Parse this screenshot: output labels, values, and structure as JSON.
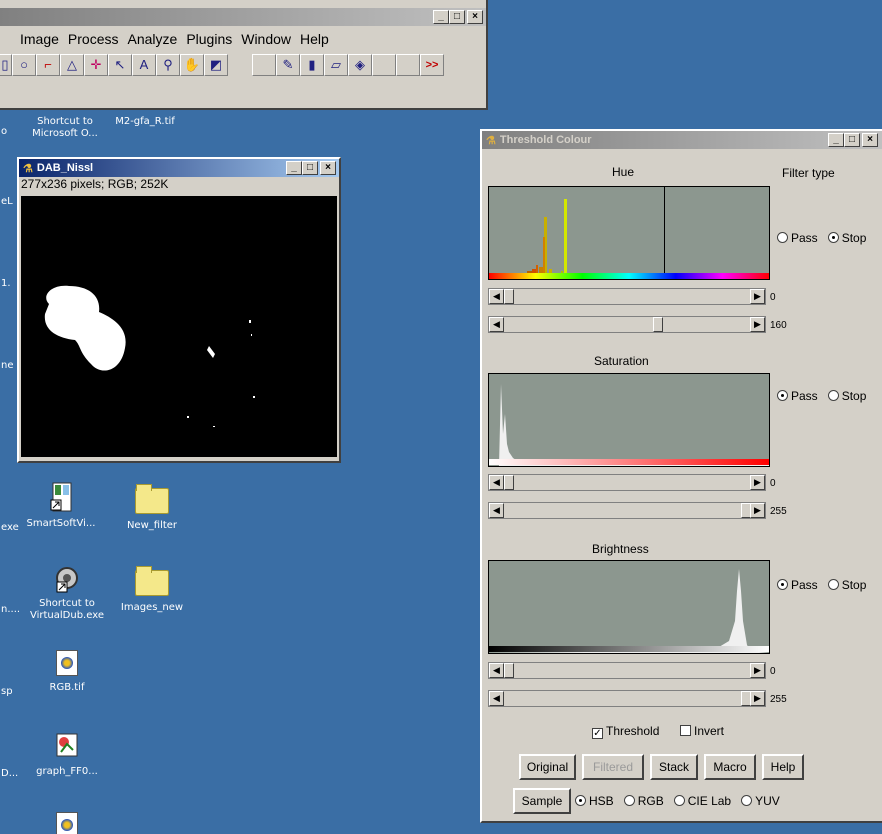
{
  "imagej": {
    "menu": [
      "Image",
      "Process",
      "Analyze",
      "Plugins",
      "Window",
      "Help"
    ],
    "tool_icons": [
      "oval-tool-icon",
      "polygon-tool-icon",
      "freehand-tool-icon",
      "angle-tool-icon",
      "point-tool-icon",
      "wand-tool-icon",
      "text-tool-icon",
      "magnifier-icon",
      "hand-icon",
      "dropper-icon",
      "pencil-icon",
      "brush-icon",
      "eraser-icon",
      "flood-fill-icon"
    ],
    "more_label": ">>",
    "window_controls": {
      "minimize": "_",
      "maximize": "□",
      "close": "×"
    }
  },
  "desktop": {
    "icons": [
      {
        "label": "Shortcut to\nMicrosoft O..."
      },
      {
        "label": "M2-gfa_R.tif"
      },
      {
        "label": "SmartSoftVi..."
      },
      {
        "label": "New_filter"
      },
      {
        "label": "Shortcut to\nVirtualDub.exe"
      },
      {
        "label": "Images_new"
      },
      {
        "label": "RGB.tif"
      },
      {
        "label": "graph_FF0..."
      }
    ],
    "edge_labels": [
      "o",
      "eL",
      "1.",
      "ne",
      "exe",
      "n....",
      "sp",
      "D..."
    ]
  },
  "dab": {
    "title": "DAB_Nissl",
    "info": "277x236 pixels; RGB; 252K"
  },
  "threshold": {
    "title": "Threshold Colour",
    "filter_type_label": "Filter type",
    "hue": {
      "label": "Hue",
      "filter": "Stop",
      "pass_label": "Pass",
      "stop_label": "Stop",
      "min": "0",
      "max": "160",
      "min_fraction": 0.0,
      "max_fraction": 0.63
    },
    "saturation": {
      "label": "Saturation",
      "filter": "Pass",
      "pass_label": "Pass",
      "stop_label": "Stop",
      "min": "0",
      "max": "255",
      "min_fraction": 0.0,
      "max_fraction": 1.0
    },
    "brightness": {
      "label": "Brightness",
      "filter": "Pass",
      "pass_label": "Pass",
      "stop_label": "Stop",
      "min": "0",
      "max": "255",
      "min_fraction": 0.0,
      "max_fraction": 1.0
    },
    "threshold_label": "Threshold",
    "threshold_checked": true,
    "invert_label": "Invert",
    "invert_checked": false,
    "buttons": {
      "original": "Original",
      "filtered": "Filtered",
      "stack": "Stack",
      "macro": "Macro",
      "help": "Help",
      "sample": "Sample"
    },
    "color_spaces": [
      "HSB",
      "RGB",
      "CIE Lab",
      "YUV"
    ],
    "selected_space": "HSB",
    "histogram_bg": "#8c978f"
  }
}
